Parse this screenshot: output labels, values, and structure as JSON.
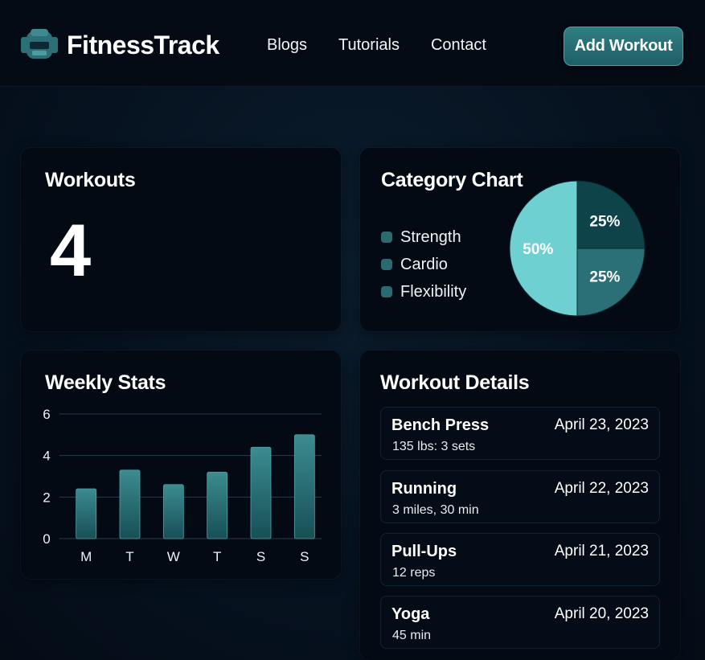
{
  "brand": {
    "name": "FitnessTrack",
    "icon": "dumbbell-headset-icon"
  },
  "nav": {
    "links": [
      "Blogs",
      "Tutorials",
      "Contact"
    ]
  },
  "header": {
    "add_button_label": "Add Workout"
  },
  "workouts_card": {
    "title": "Workouts",
    "count": "4"
  },
  "category_card": {
    "title": "Category Chart",
    "legend": [
      "Strength",
      "Cardio",
      "Flexibility"
    ]
  },
  "weekly_card": {
    "title": "Weekly Stats"
  },
  "details_card": {
    "title": "Workout Details",
    "items": [
      {
        "name": "Bench Press",
        "date": "April 23, 2023",
        "detail": "135 lbs: 3 sets"
      },
      {
        "name": "Running",
        "date": "April 22, 2023",
        "detail": "3 miles, 30 min"
      },
      {
        "name": "Pull-Ups",
        "date": "April 21, 2023",
        "detail": "12 reps"
      },
      {
        "name": "Yoga",
        "date": "April 20, 2023",
        "detail": "45 min"
      }
    ]
  },
  "colors": {
    "accent": "#2f7e83",
    "pie_light": "#6fd0d2",
    "pie_mid": "#2c7077",
    "pie_dark": "#0f434a",
    "bar": "#2f777c"
  },
  "chart_data": [
    {
      "type": "pie",
      "title": "Category Chart",
      "slices": [
        {
          "label": "50%",
          "value": 50,
          "color": "#6fd0d2"
        },
        {
          "label": "25%",
          "value": 25,
          "color": "#0f434a"
        },
        {
          "label": "25%",
          "value": 25,
          "color": "#2c7077"
        }
      ]
    },
    {
      "type": "bar",
      "title": "Weekly Stats",
      "categories": [
        "M",
        "T",
        "W",
        "T",
        "S",
        "S"
      ],
      "values": [
        2.4,
        3.3,
        2.6,
        3.2,
        4.4,
        5.0
      ],
      "ylim": [
        0,
        6
      ],
      "yticks": [
        0,
        2,
        4,
        6
      ],
      "grid": true
    }
  ]
}
